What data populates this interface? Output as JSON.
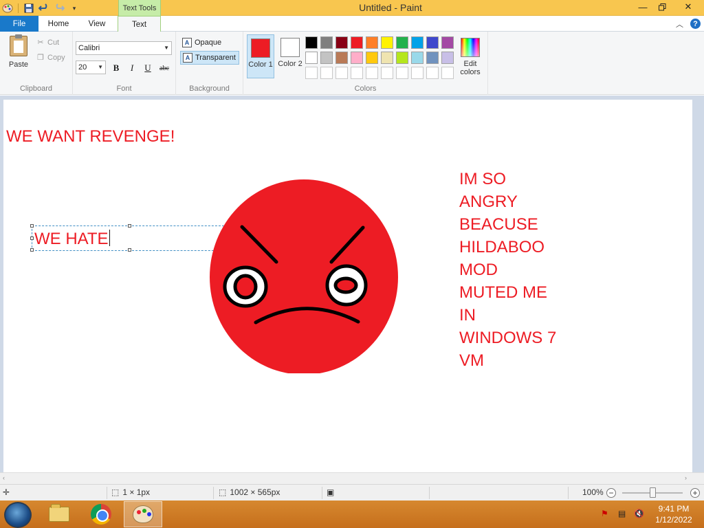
{
  "window": {
    "title": "Untitled - Paint",
    "context_tab": "Text Tools"
  },
  "tabs": {
    "file": "File",
    "home": "Home",
    "view": "View",
    "text": "Text"
  },
  "clipboard": {
    "paste": "Paste",
    "cut": "Cut",
    "copy": "Copy",
    "group": "Clipboard"
  },
  "font": {
    "family": "Calibri",
    "size": "20",
    "bold": "B",
    "italic": "I",
    "underline": "U",
    "strike": "abc",
    "group": "Font"
  },
  "background": {
    "opaque": "Opaque",
    "transparent": "Transparent",
    "group": "Background",
    "selected": "Transparent"
  },
  "colors": {
    "group": "Colors",
    "color1_label": "Color 1",
    "color1": "#ed1c24",
    "color2_label": "Color 2",
    "color2": "#ffffff",
    "edit": "Edit colors",
    "palette_row1": [
      "#000000",
      "#7f7f7f",
      "#880015",
      "#ed1c24",
      "#ff7f27",
      "#fff200",
      "#22b14c",
      "#00a2e8",
      "#3f48cc",
      "#a349a4"
    ],
    "palette_row2": [
      "#ffffff",
      "#c3c3c3",
      "#b97a57",
      "#ffaec9",
      "#ffc90e",
      "#efe4b0",
      "#b5e61d",
      "#99d9ea",
      "#7092be",
      "#c8bfe7"
    ]
  },
  "canvas": {
    "headline": "WE WANT REVENGE!",
    "typing": "WE HATE",
    "right_lines": [
      "IM SO",
      "ANGRY",
      "BEACUSE",
      "HILDABOO",
      "MOD",
      "MUTED ME",
      "IN",
      "WINDOWS 7",
      "VM"
    ],
    "face_color": "#ed1c24"
  },
  "status": {
    "selection": "1 × 1px",
    "image_size": "1002 × 565px",
    "zoom": "100%"
  },
  "taskbar": {
    "time": "9:41 PM",
    "date": "1/12/2022"
  }
}
